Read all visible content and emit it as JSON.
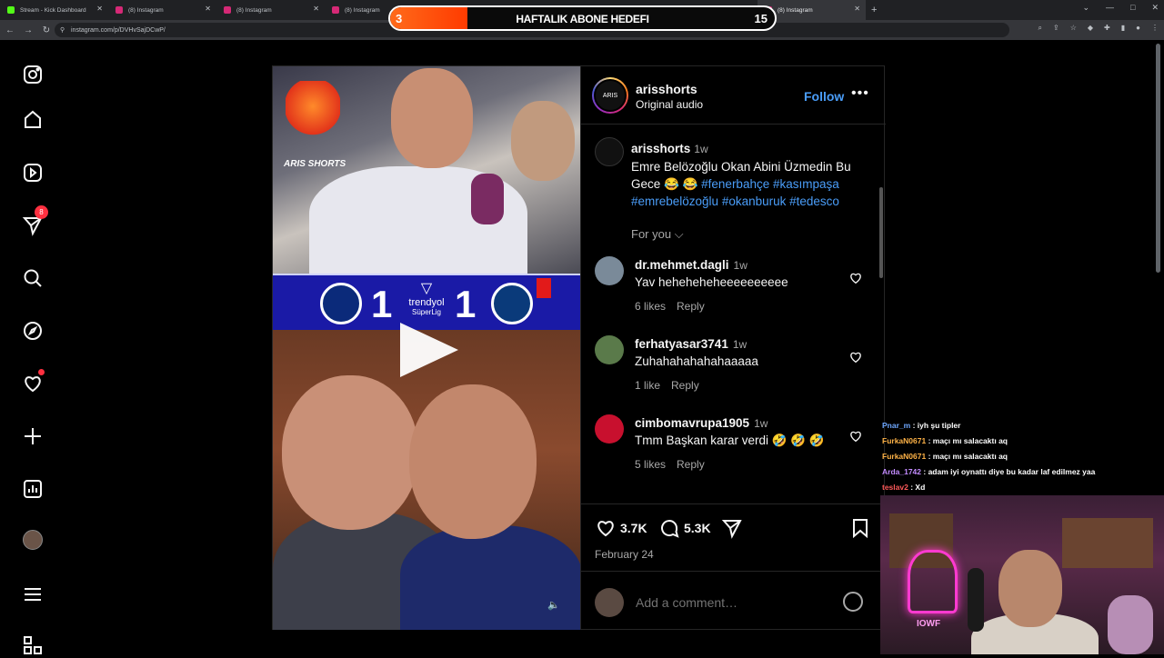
{
  "browser": {
    "tabs": [
      {
        "title": "Stream - Kick Dashboard",
        "color": "#53fc18",
        "active": false
      },
      {
        "title": "(8) Instagram",
        "color": "#d62976",
        "active": false
      },
      {
        "title": "(8) Instagram",
        "color": "#d62976",
        "active": false
      },
      {
        "title": "(8) Instagram",
        "color": "#d62976",
        "active": false
      },
      {
        "title": "(8) Instagram",
        "color": "#d62976",
        "active": false
      },
      {
        "title": "(8) Instagram",
        "color": "#d62976",
        "active": false
      },
      {
        "title": "(8) Instagram",
        "color": "#d62976",
        "active": false
      },
      {
        "title": "(8) Instagram",
        "color": "#d62976",
        "active": true
      }
    ],
    "url": "instagram.com/p/DVHvSajDCwP/"
  },
  "overlay": {
    "goal_title": "HAFTALIK ABONE HEDEFI",
    "current": "3",
    "target": "15",
    "progress_fraction": 0.2
  },
  "nav": {
    "notifications_badge": "8"
  },
  "media": {
    "logo_text": "ARIS SHORTS",
    "score_home": "1",
    "score_away": "1",
    "league": "trendyol",
    "league_sub": "SüperLig"
  },
  "post": {
    "username": "arisshorts",
    "audio": "Original audio",
    "follow": "Follow",
    "more": "•••",
    "caption_user": "arisshorts",
    "caption_time": "1w",
    "caption_text": "Emre Belözoğlu Okan Abini Üzmedin Bu Gece 😂 😂",
    "caption_tags": "#fenerbahçe #kasımpaşa #emrebelözoğlu #okanburuk #tedesco",
    "for_you": "For you",
    "comments": [
      {
        "user": "dr.mehmet.dagli",
        "time": "1w",
        "text": "Yav heheheheheeeeeeeeee",
        "likes": "6 likes",
        "reply": "Reply",
        "avatar_color": "#7a8a99"
      },
      {
        "user": "ferhatyasar3741",
        "time": "1w",
        "text": "Zuhahahahahahaaaaa",
        "likes": "1 like",
        "reply": "Reply",
        "avatar_color": "#5a7a4a"
      },
      {
        "user": "cimbomavrupa1905",
        "time": "1w",
        "text": "Tmm Başkan karar verdi 🤣 🤣 🤣",
        "likes": "5 likes",
        "reply": "Reply",
        "avatar_color": "#c8102e"
      }
    ],
    "like_count": "3.7K",
    "comment_count": "5.3K",
    "date": "February 24",
    "add_comment_placeholder": "Add a comment…"
  },
  "chat": [
    {
      "user": "Pnar_m",
      "msg": ": iyh şu tipler",
      "cls": "u1"
    },
    {
      "user": "FurkaN0671",
      "msg": ": maçı mı salacaktı aq",
      "cls": "u2"
    },
    {
      "user": "FurkaN0671",
      "msg": ": maçı mı salacaktı aq",
      "cls": "u2"
    },
    {
      "user": "Arda_1742",
      "msg": ": adam iyi oynattı diye bu kadar laf edilmez yaa",
      "cls": "u3"
    },
    {
      "user": "teslav2",
      "msg": ": Xd",
      "cls": "u4"
    }
  ],
  "cam": {
    "neon_text": "IOWF"
  }
}
